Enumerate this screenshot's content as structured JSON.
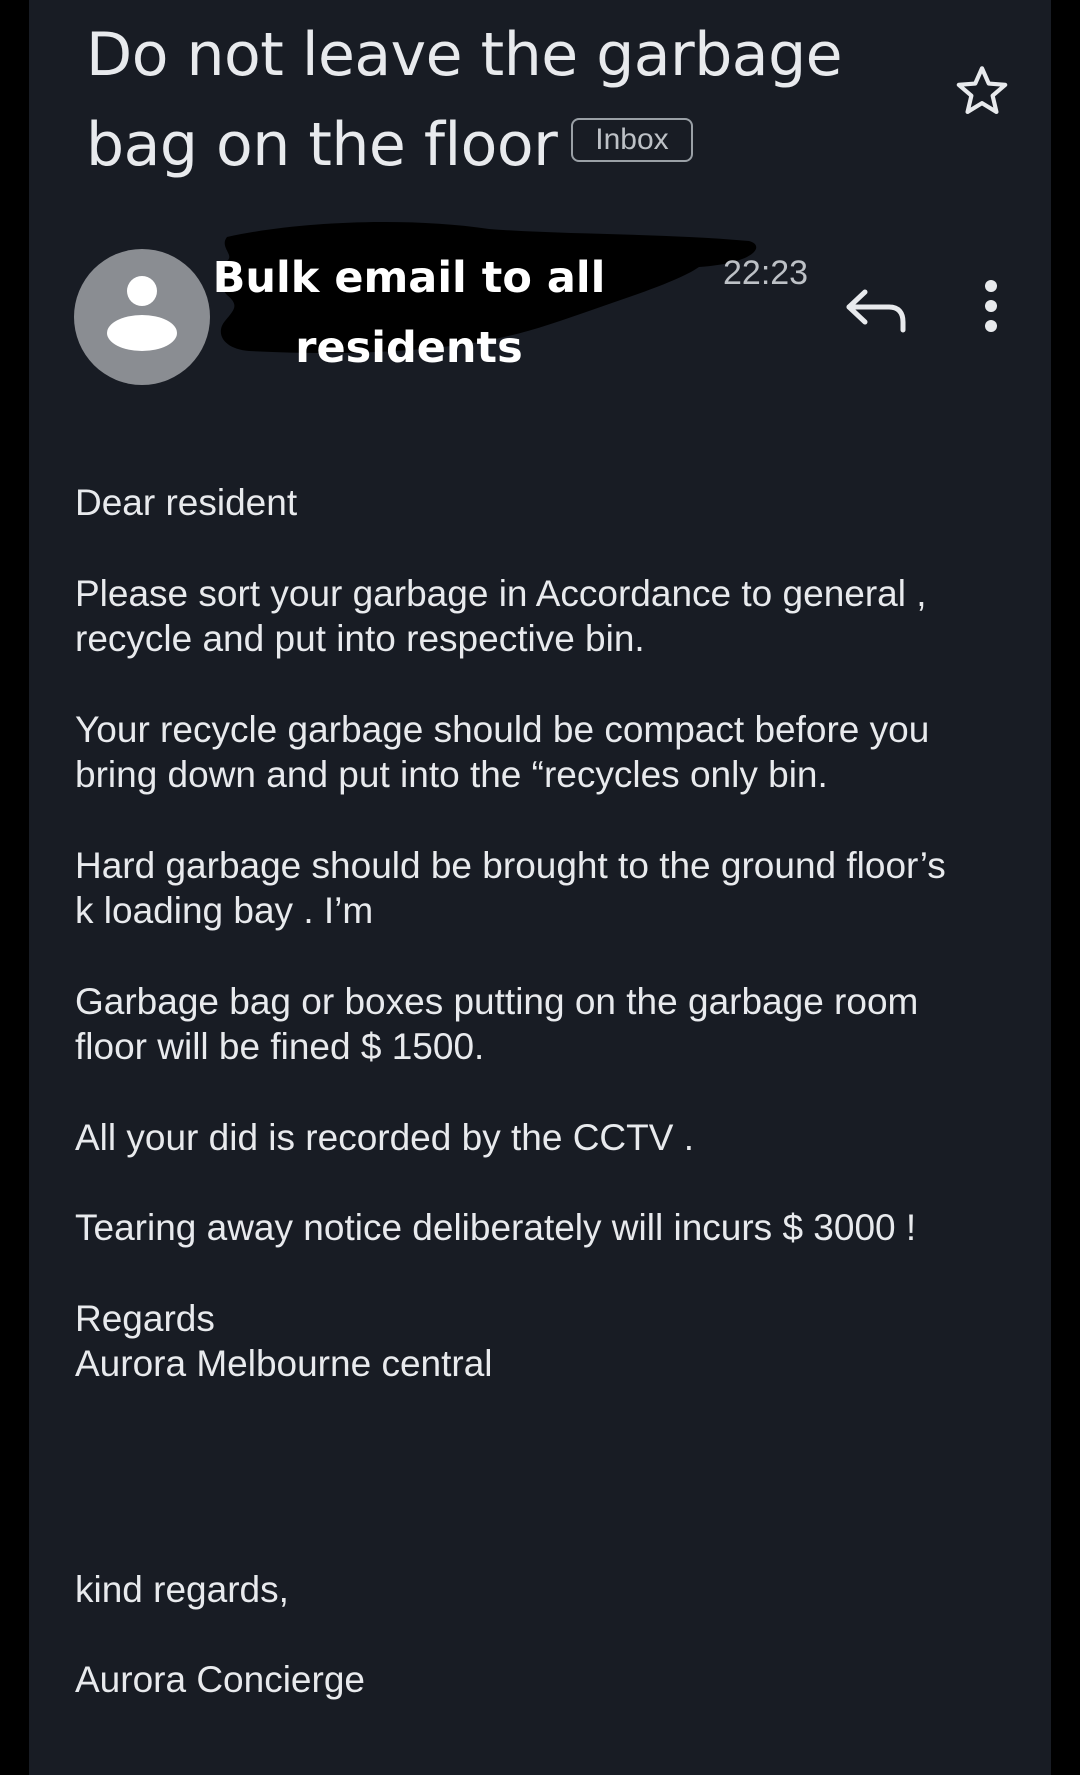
{
  "email": {
    "subject": "Do not leave the garbage bag on the floor",
    "label_badge": "Inbox",
    "sender": "Bulk email to all residents",
    "time": "22:23",
    "body": [
      "Dear resident",
      "Please sort your garbage in Accordance to general ,\nrecycle and put into respective bin.",
      "Your recycle garbage should be compact before you\nbring down and put into the “recycles only bin.",
      "Hard garbage should be brought to the ground floor’s\nk loading bay . I’m",
      "Garbage bag or boxes putting on the garbage room\nfloor will be fined $ 1500.",
      "All your did is recorded by the CCTV .",
      "Tearing away notice deliberately will incurs $ 3000 !",
      "Regards\nAurora Melbourne central",
      "kind regards,",
      "Aurora Concierge"
    ]
  },
  "icons": {
    "star": "star-outline-icon",
    "avatar": "person-icon",
    "reply": "reply-icon",
    "more": "more-vertical-icon"
  },
  "colors": {
    "background": "#181c24",
    "text": "#e8eaed",
    "secondary_text": "#bdc1c6",
    "avatar_bg": "#8a8d92"
  }
}
